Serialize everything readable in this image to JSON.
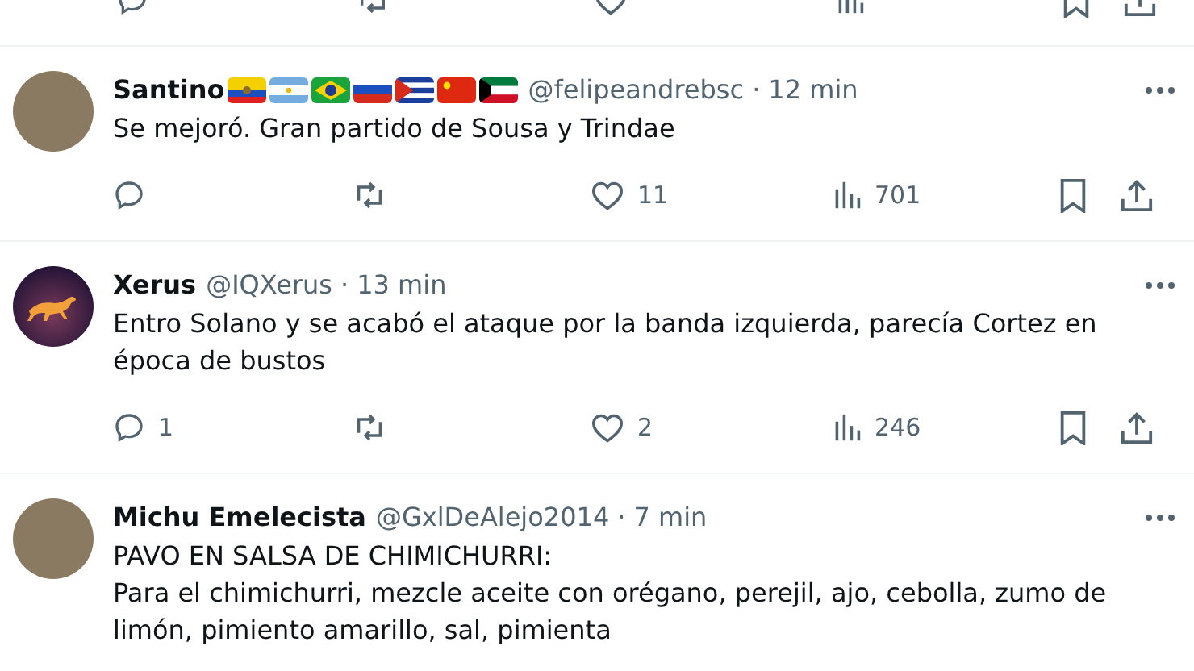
{
  "tweets": [
    {
      "name": "Santino",
      "avatar": {
        "kind": "photo"
      },
      "flags": [
        {
          "kind": "ecuador"
        },
        {
          "kind": "argentina"
        },
        {
          "kind": "brazil"
        },
        {
          "kind": "russia"
        },
        {
          "kind": "cuba"
        },
        {
          "kind": "china"
        },
        {
          "kind": "kuwait"
        }
      ],
      "handle": "@felipeandrebsc",
      "separator": "·",
      "time": "12 min",
      "text": [
        "Se mejoró.  Gran partido de Sousa y Trindae"
      ],
      "actions": {
        "likes": "11",
        "views": "701"
      }
    },
    {
      "name": "Xerus",
      "avatar": {
        "kind": "cat"
      },
      "handle": "@IQXerus",
      "separator": "·",
      "time": "13 min",
      "text": [
        "Entro Solano y se acabó el ataque por la banda izquierda, parecía Cortez en época de bustos"
      ],
      "actions": {
        "replies": "1",
        "likes": "2",
        "views": "246"
      }
    },
    {
      "name": "Michu Emelecista",
      "avatar": {
        "kind": "photo"
      },
      "handle": "@GxlDeAlejo2014",
      "separator": "·",
      "time": "7 min",
      "text": [
        "PAVO EN SALSA DE CHIMICHURRI:",
        "Para el chimichurri, mezcle aceite con orégano, perejil, ajo, cebolla, zumo de limón, pimiento amarillo, sal, pimienta"
      ]
    }
  ]
}
